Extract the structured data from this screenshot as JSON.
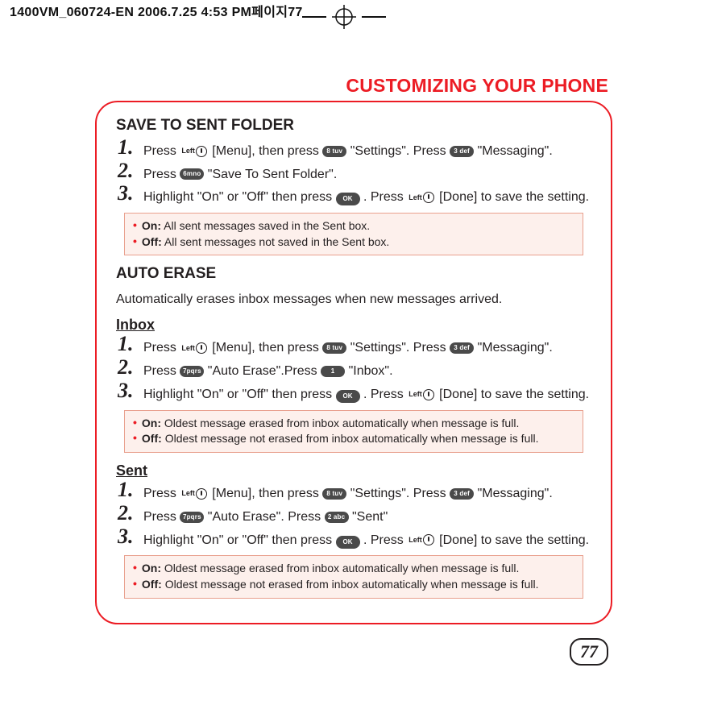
{
  "print_header": "1400VM_060724-EN  2006.7.25 4:53 PM페이지77",
  "heading": "CUSTOMIZING YOUR PHONE",
  "page_number": "77",
  "s1": {
    "title": "SAVE TO SENT FOLDER",
    "step1_a": "Press ",
    "step1_b": " [Menu], then press ",
    "step1_c": " \"Settings\".  Press ",
    "step1_d": " \"Messaging\".",
    "step2_a": "Press ",
    "step2_b": " \"Save To Sent Folder\".",
    "step3_a": "Highlight \"On\" or \"Off\" then press ",
    "step3_b": " .  Press ",
    "step3_c": " [Done] to save the setting.",
    "note_on": "All sent messages saved in the Sent box.",
    "note_off": "All sent messages not saved in the Sent box."
  },
  "s2": {
    "title": "AUTO ERASE",
    "lead": "Automatically erases inbox messages when new messages arrived.",
    "inbox": {
      "title": "Inbox",
      "step1_a": "Press ",
      "step1_b": " [Menu], then press ",
      "step1_c": " \"Settings\".  Press ",
      "step1_d": " \"Messaging\".",
      "step2_a": "Press ",
      "step2_b": " \"Auto Erase\".Press ",
      "step2_c": " \"Inbox\".",
      "step3_a": "Highlight \"On\" or \"Off\" then press ",
      "step3_b": " .  Press ",
      "step3_c": " [Done] to save the setting.",
      "note_on": "Oldest message erased from inbox automatically when message is full.",
      "note_off": "Oldest message not erased from inbox automatically when message is full."
    },
    "sent": {
      "title": "Sent",
      "step1_a": "Press ",
      "step1_b": " [Menu], then press ",
      "step1_c": " \"Settings\".  Press ",
      "step1_d": " \"Messaging\".",
      "step2_a": "Press ",
      "step2_b": " \"Auto Erase\". Press ",
      "step2_c": " \"Sent\"",
      "step3_a": "Highlight \"On\" or \"Off\" then press ",
      "step3_b": " .  Press ",
      "step3_c": " [Done] to save the setting.",
      "note_on": "Oldest message erased from inbox automatically when message is full.",
      "note_off": "Oldest message not erased from inbox automatically when message is full."
    }
  },
  "keys": {
    "left": "Left",
    "k8": "8 tuv",
    "k3": "3 def",
    "k6": "6mno",
    "k7": "7pqrs",
    "k1": "1",
    "k2": "2 abc",
    "ok": "OK"
  },
  "labels": {
    "on": "On:",
    "off": "Off:"
  }
}
